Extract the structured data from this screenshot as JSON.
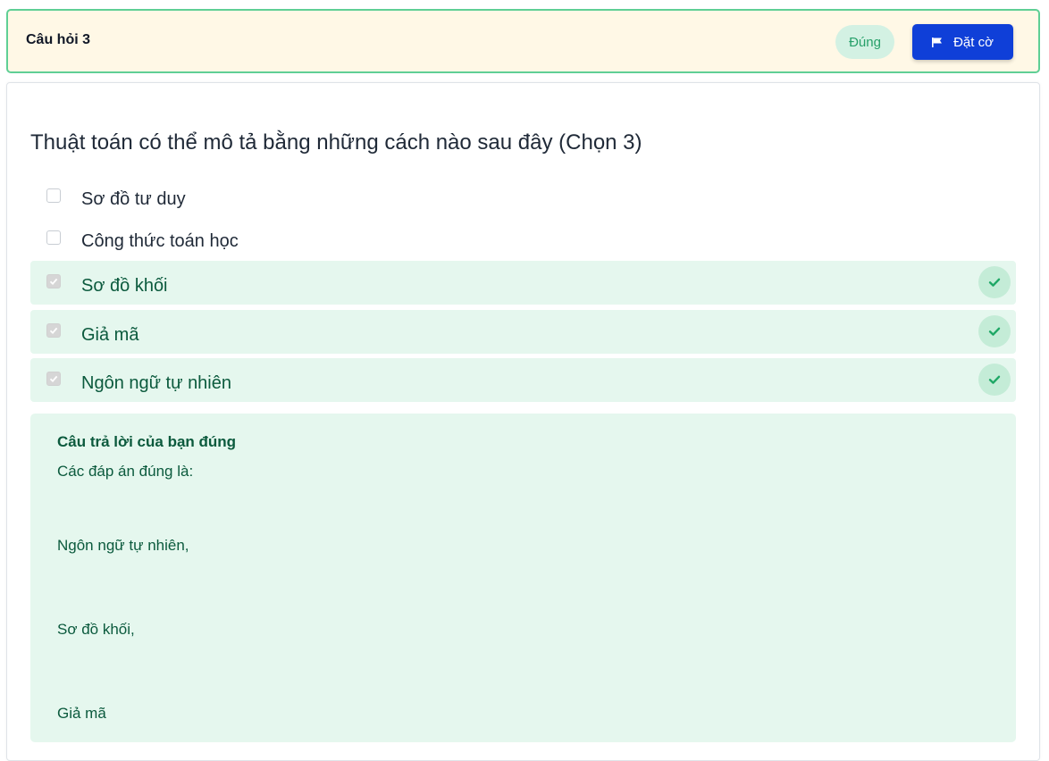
{
  "header": {
    "title": "Câu hỏi 3",
    "status": "Đúng",
    "flag_label": "Đặt cờ"
  },
  "question": {
    "text": "Thuật toán có thể mô tả bằng những cách nào sau đây (Chọn 3)",
    "options": [
      {
        "label": "Sơ đồ tư duy",
        "checked": false,
        "correct": false
      },
      {
        "label": "Công thức toán học",
        "checked": false,
        "correct": false
      },
      {
        "label": "Sơ đồ khối",
        "checked": true,
        "correct": true
      },
      {
        "label": "Giả mã",
        "checked": true,
        "correct": true
      },
      {
        "label": "Ngôn ngữ tự nhiên",
        "checked": true,
        "correct": true
      }
    ]
  },
  "feedback": {
    "title": "Câu trả lời của bạn đúng",
    "intro": "Các đáp án đúng là:",
    "answers": [
      "Ngôn ngữ tự nhiên,",
      "Sơ đồ khối,",
      "Giả mã"
    ]
  },
  "colors": {
    "accent": "#0f3fd8",
    "success": "#27a06a",
    "correct_bg": "#e5f7ee",
    "header_bg": "#fff8e6",
    "header_border": "#5fcf95"
  }
}
